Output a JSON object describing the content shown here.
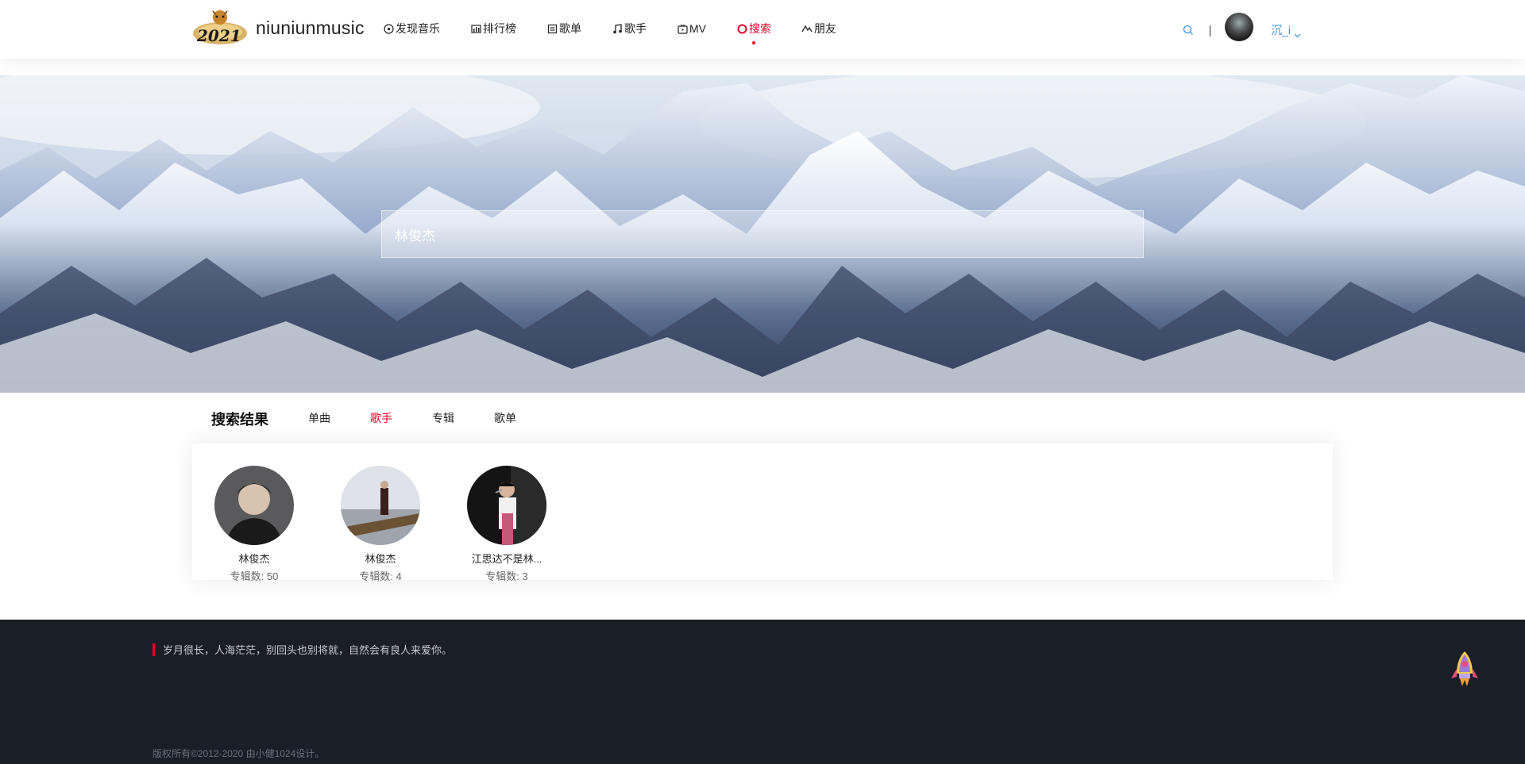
{
  "app": {
    "logo_text": "niuniunmusic"
  },
  "nav": [
    {
      "label": "发现音乐",
      "icon": "disc-icon",
      "active": false
    },
    {
      "label": "排行榜",
      "icon": "chart-icon",
      "active": false
    },
    {
      "label": "歌单",
      "icon": "playlist-icon",
      "active": false
    },
    {
      "label": "歌手",
      "icon": "music-note-icon",
      "active": false
    },
    {
      "label": "MV",
      "icon": "tv-icon",
      "active": false
    },
    {
      "label": "搜索",
      "icon": "search-circle-icon",
      "active": true
    },
    {
      "label": "朋友",
      "icon": "friends-icon",
      "active": false
    }
  ],
  "user": {
    "name": "沉_i"
  },
  "search": {
    "value": "林俊杰"
  },
  "results": {
    "title": "搜索结果",
    "tabs": [
      {
        "label": "单曲",
        "active": false
      },
      {
        "label": "歌手",
        "active": true
      },
      {
        "label": "专辑",
        "active": false
      },
      {
        "label": "歌单",
        "active": false
      }
    ],
    "artists": [
      {
        "name": "林俊杰",
        "count": "专辑数: 50"
      },
      {
        "name": "林俊杰",
        "count": "专辑数: 4"
      },
      {
        "name": "江思达不是林...",
        "count": "专辑数: 3"
      }
    ]
  },
  "footer": {
    "quote": "岁月很长，人海茫茫，别回头也别将就，自然会有良人来爱你。",
    "copyright": "版权所有©2012-2020 由小健1024设计。"
  },
  "colors": {
    "accent": "#e60026",
    "link": "#3b8fe0",
    "footer_bg": "#1a1e27"
  }
}
